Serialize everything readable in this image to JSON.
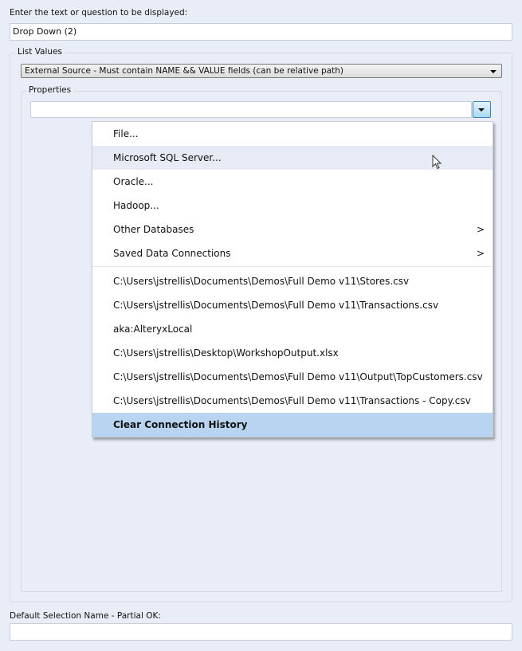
{
  "question_label": "Enter the text or question to be displayed:",
  "question_value": "Drop Down (2)",
  "list_values": {
    "group_label": "List Values",
    "source_select": "External Source - Must contain NAME && VALUE fields  (can be relative path)",
    "properties_label": "Properties",
    "properties_value": ""
  },
  "menu": {
    "items": [
      {
        "label": "File..."
      },
      {
        "label": "Microsoft SQL Server..."
      },
      {
        "label": "Oracle..."
      },
      {
        "label": "Hadoop..."
      },
      {
        "label": "Other Databases",
        "submenu": ">"
      },
      {
        "label": "Saved Data Connections",
        "submenu": ">"
      }
    ],
    "history": [
      "C:\\Users\\jstrellis\\Documents\\Demos\\Full Demo v11\\Stores.csv",
      "C:\\Users\\jstrellis\\Documents\\Demos\\Full Demo v11\\Transactions.csv",
      "aka:AlteryxLocal",
      "C:\\Users\\jstrellis\\Desktop\\WorkshopOutput.xlsx",
      "C:\\Users\\jstrellis\\Documents\\Demos\\Full Demo v11\\Output\\TopCustomers.csv",
      "C:\\Users\\jstrellis\\Documents\\Demos\\Full Demo v11\\Transactions - Copy.csv"
    ],
    "clear": "Clear Connection History"
  },
  "default_label": "Default Selection Name - Partial OK:",
  "default_value": ""
}
